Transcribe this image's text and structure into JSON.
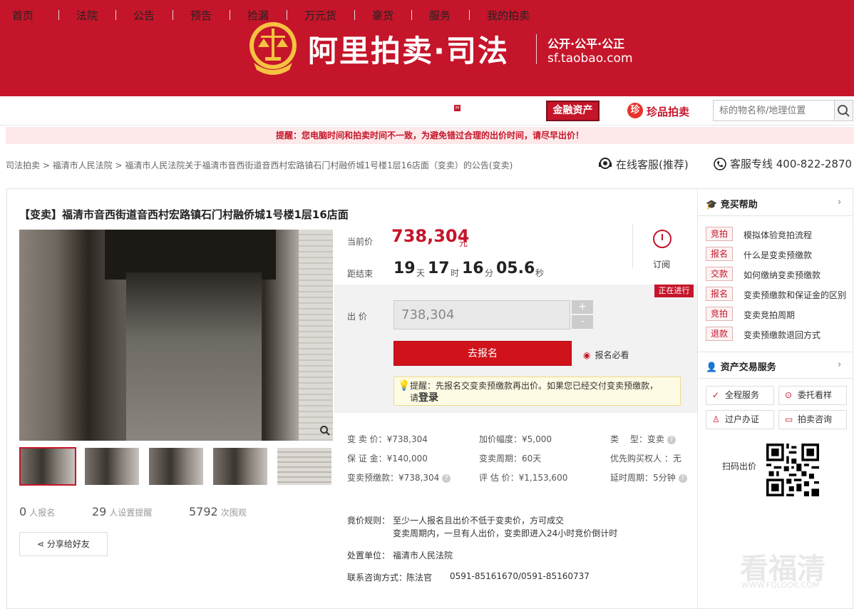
{
  "header": {
    "brand": "阿里拍卖·司法",
    "slogan": "公开·公平·公正",
    "domain": "sf.taobao.com",
    "emblem_icon": "court-emblem-icon"
  },
  "nav": {
    "items": [
      "首页",
      "法院",
      "公告",
      "预告",
      "捡漏",
      "万元货",
      "豪货",
      "服务",
      "我的拍卖"
    ],
    "hot_badge": "H",
    "finance": "金融资产",
    "zhenpin": "珍品拍卖",
    "zhenpin_icon": "zhenpin-logo-icon",
    "search_placeholder": "标的物名称/地理位置"
  },
  "tip": "提醒：您电脑时间和拍卖时间不一致，为避免错过合理的出价时间，请尽早出价！",
  "breadcrumb": "司法拍卖 > 福清市人民法院 > 福清市人民法院关于福清市音西街道音西村宏路镇石门村融侨城1号楼1层16店面（变卖）的公告(变卖)",
  "contact": {
    "service": "在线客服(推荐)",
    "hotline": "客服专线 400-822-2870"
  },
  "item": {
    "title": "【变卖】福清市音西街道音西村宏路镇石门村融侨城1号楼1层16店面",
    "current_price_label": "当前价",
    "current_price": "738,304",
    "price_unit": "元",
    "countdown_label": "距结束",
    "days": "19",
    "days_unit": "天",
    "hours": "17",
    "hours_unit": "时",
    "minutes": "16",
    "minutes_unit": "分",
    "seconds": "05.6",
    "seconds_unit": "秒",
    "subscribe": "订阅",
    "status": "正在进行",
    "bid_label": "出  价",
    "bid_value": "738,304",
    "plus": "+",
    "minus": "-",
    "signup": "去报名",
    "must_read": "报名必看",
    "notice": "提醒：先报名交变卖预缴款再出价。如果您已经交付变卖预缴款，",
    "notice_login_prefix": "请",
    "notice_login": "登录",
    "stats": {
      "signup_count": "0",
      "signup_label": "人报名",
      "remind_count": "29",
      "remind_label": "人设置提醒",
      "view_count": "5792",
      "view_label": "次围观"
    },
    "share": "分享给好友"
  },
  "details": {
    "col1": [
      "变 卖 价：¥738,304",
      "保 证 金：¥140,000",
      "变卖预缴款：¥738,304"
    ],
    "col2": [
      "加价幅度：¥5,000",
      "变卖周期：60天",
      "评 估 价：¥1,153,600"
    ],
    "col3": [
      "类　 型：变卖",
      "优先购买权人 ：无",
      "延时周期：5分钟"
    ],
    "rule_label": "竟价规则：",
    "rule_1": "至少一人报名且出价不低于变卖价，方可成交",
    "rule_2": "变卖周期内，一旦有人出价，变卖即进入24小时竞价倒计时",
    "unit_label": "处置单位：",
    "unit": "福清市人民法院",
    "contact_label": "联系咨询方式：",
    "contact_person": "陈法官",
    "contact_phone": "0591-85161670/0591-85160737"
  },
  "sidebar": {
    "help_title": "竞买帮助",
    "help_items": [
      {
        "tag": "竞拍",
        "text": "模拟体验竞拍流程"
      },
      {
        "tag": "报名",
        "text": "什么是变卖预缴款"
      },
      {
        "tag": "交款",
        "text": "如何缴纳变卖预缴款"
      },
      {
        "tag": "报名",
        "text": "变卖预缴款和保证金的区别"
      },
      {
        "tag": "竞拍",
        "text": "变卖竞拍周期"
      },
      {
        "tag": "退款",
        "text": "变卖预缴款退回方式"
      }
    ],
    "asset_title": "资产交易服务",
    "services": [
      "全程服务",
      "委托看样",
      "过户办证",
      "拍卖咨询"
    ],
    "scan": "扫码出价",
    "watermark": "看福清",
    "watermark_url": "WWW.FQLOOK.COM"
  }
}
